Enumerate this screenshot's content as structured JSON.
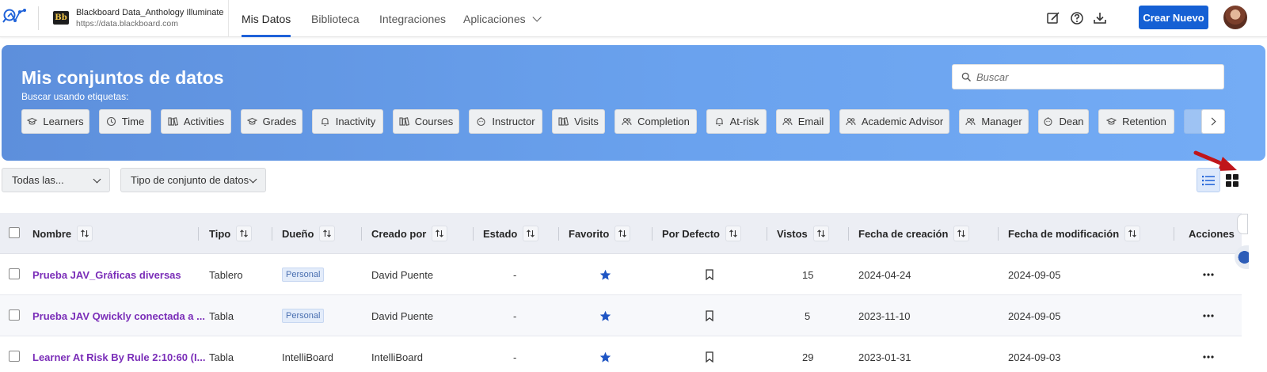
{
  "header": {
    "institution_name": "Blackboard Data_Anthology Illuminate",
    "institution_url": "https://data.blackboard.com",
    "bb_logo_text": "Bb",
    "nav": [
      {
        "label": "Mis Datos",
        "active": true
      },
      {
        "label": "Biblioteca",
        "active": false
      },
      {
        "label": "Integraciones",
        "active": false
      },
      {
        "label": "Aplicaciones",
        "active": false
      }
    ],
    "icons": [
      "edit-icon",
      "help-icon",
      "download-icon"
    ],
    "create_button": "Crear Nuevo",
    "accent_color": "#1560d4"
  },
  "hero": {
    "title": "Mis conjuntos de datos",
    "subtitle": "Buscar usando etiquetas:",
    "search_placeholder": "Buscar",
    "tags": [
      {
        "label": "Learners",
        "icon": "cap-icon"
      },
      {
        "label": "Time",
        "icon": "clock-icon"
      },
      {
        "label": "Activities",
        "icon": "books-icon"
      },
      {
        "label": "Grades",
        "icon": "cap-icon"
      },
      {
        "label": "Inactivity",
        "icon": "bell-icon"
      },
      {
        "label": "Courses",
        "icon": "books-icon"
      },
      {
        "label": "Instructor",
        "icon": "face-icon"
      },
      {
        "label": "Visits",
        "icon": "books-icon"
      },
      {
        "label": "Completion",
        "icon": "people-icon"
      },
      {
        "label": "At-risk",
        "icon": "bell-icon"
      },
      {
        "label": "Email",
        "icon": "people-icon"
      },
      {
        "label": "Academic Advisor",
        "icon": "people-icon"
      },
      {
        "label": "Manager",
        "icon": "people-icon"
      },
      {
        "label": "Dean",
        "icon": "face-icon"
      },
      {
        "label": "Retention",
        "icon": "cap-icon"
      }
    ]
  },
  "filters": {
    "owner_select": "Todas las...",
    "type_select": "Tipo de conjunto de datos",
    "active_view": "list"
  },
  "table": {
    "columns": [
      "Nombre",
      "Tipo",
      "Dueño",
      "Creado por",
      "Estado",
      "Favorito",
      "Por Defecto",
      "Vistos",
      "Fecha de creación",
      "Fecha de modificación",
      "Acciones"
    ],
    "rows": [
      {
        "name": "Prueba JAV_Gráficas diversas",
        "type": "Tablero",
        "owner": "Personal",
        "owner_badge": true,
        "created_by": "David Puente",
        "status": "-",
        "views": "15",
        "created": "2024-04-24",
        "modified": "2024-09-05"
      },
      {
        "name": "Prueba JAV Qwickly conectada a ...",
        "type": "Tabla",
        "owner": "Personal",
        "owner_badge": true,
        "created_by": "David Puente",
        "status": "-",
        "views": "5",
        "created": "2023-11-10",
        "modified": "2024-09-05"
      },
      {
        "name": "Learner At Risk By Rule 2:10:60 (I...",
        "type": "Tabla",
        "owner": "IntelliBoard",
        "owner_badge": false,
        "created_by": "IntelliBoard",
        "status": "-",
        "views": "29",
        "created": "2023-01-31",
        "modified": "2024-09-03"
      }
    ]
  }
}
